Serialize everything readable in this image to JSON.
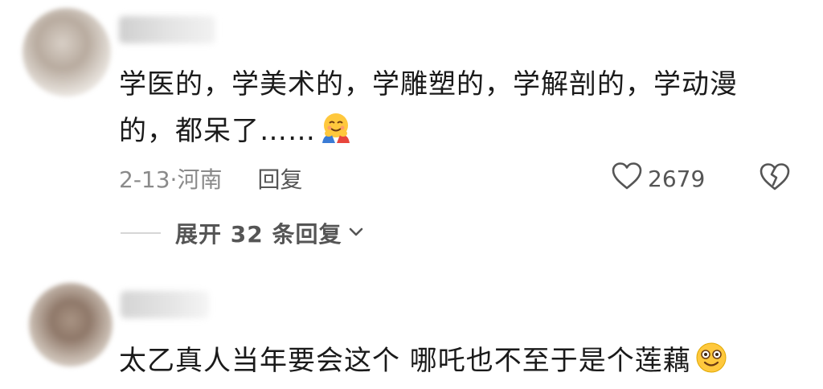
{
  "comments": [
    {
      "text_line1": "学医的，学美术的，学雕塑的，学解剖的，学动漫",
      "text_line2": "的，都呆了……",
      "date_location": "2-13·河南",
      "reply_label": "回复",
      "like_count": "2679",
      "expand_label": "展开 32 条回复",
      "emoji": "hugging-face-emoji"
    },
    {
      "text": "太乙真人当年要会这个  哪吒也不至于是个莲藕",
      "emoji": "smiling-face-emoji"
    }
  ],
  "colors": {
    "text": "#1a1a1a",
    "meta": "#8a8a8a",
    "icon": "#555555"
  }
}
